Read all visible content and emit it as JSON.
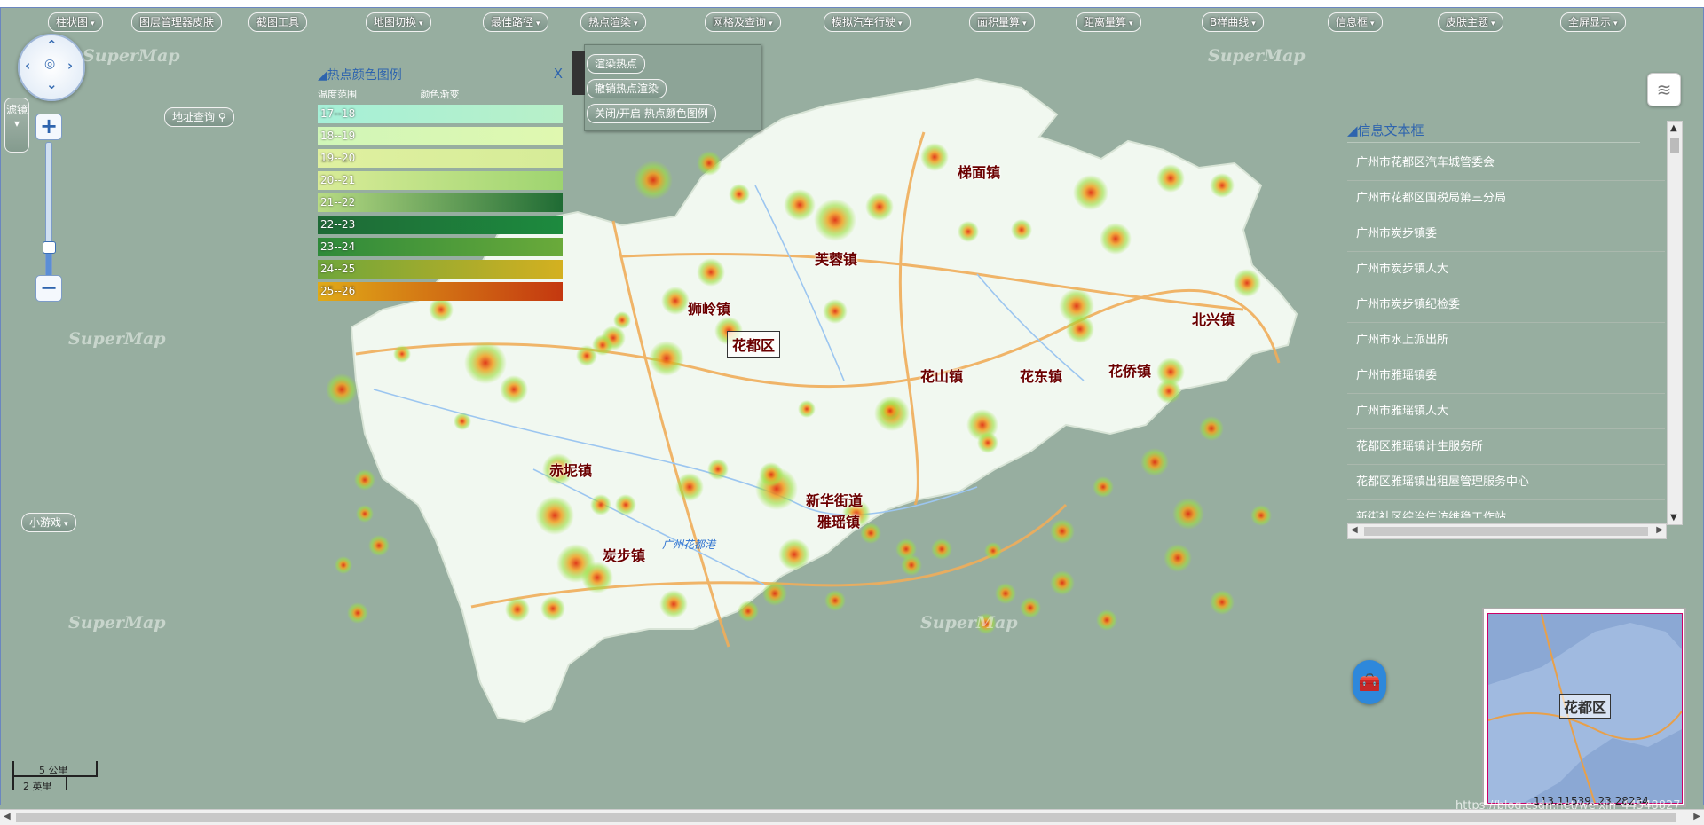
{
  "toolbar": {
    "items": [
      "柱状图",
      "图层管理器皮肤",
      "截图工具",
      "地图切换",
      "最佳路径",
      "热点渲染",
      "网格及查询",
      "模拟汽车行驶",
      "面积量算",
      "距离量算",
      "B样曲线",
      "信息框",
      "皮肤主题",
      "全屏显示"
    ]
  },
  "controls": {
    "filter": "滤镜",
    "address_query": "地址查询",
    "mini_game": "小游戏"
  },
  "watermark": "SuperMap",
  "hotspot_menu": {
    "items": [
      "渲染热点",
      "撤销热点渲染",
      "关闭/开启 热点颜色图例"
    ]
  },
  "legend": {
    "title": "热点颜色图例",
    "close": "X",
    "col_range": "温度范围",
    "col_gradient": "颜色渐变",
    "rows": [
      "17--18",
      "18--19",
      "19--20",
      "20--21",
      "21--22",
      "22--23",
      "23--24",
      "24--25",
      "25--26"
    ],
    "colors": [
      [
        "#a6f0d8",
        "#b8f0c8"
      ],
      [
        "#d0f6b8",
        "#e0f8b0"
      ],
      [
        "#dff0a0",
        "#d6ec98"
      ],
      [
        "#d9ec98",
        "#9ed470"
      ],
      [
        "#b8dc84",
        "#1f6b34"
      ],
      [
        "#1e6a36",
        "#1d8a3e"
      ],
      [
        "#2e8a3a",
        "#6aaa3a"
      ],
      [
        "#6fa63a",
        "#d4b020"
      ],
      [
        "#e0aa18",
        "#c43810"
      ]
    ]
  },
  "info_panel": {
    "title": "信息文本框",
    "items": [
      "广州市花都区汽车城管委会",
      "广州市花都区国税局第三分局",
      "广州市炭步镇委",
      "广州市炭步镇人大",
      "广州市炭步镇纪检委",
      "广州市水上派出所",
      "广州市雅瑶镇委",
      "广州市雅瑶镇人大",
      "花都区雅瑶镇计生服务所",
      "花都区雅瑶镇出租屋管理服务中心",
      "新街社区综治信访维稳工作站"
    ]
  },
  "map": {
    "district": "花都区",
    "places": [
      "梯面镇",
      "芙蓉镇",
      "狮岭镇",
      "北兴镇",
      "花山镇",
      "花东镇",
      "花侨镇",
      "新华街道",
      "雅瑶镇",
      "炭步镇",
      "赤坭镇"
    ],
    "river": "广州花都港"
  },
  "scale": {
    "km": "5 公里",
    "mi": "2 英里"
  },
  "overview": {
    "label": "花都区"
  },
  "coords": "113.11539, 23.28234",
  "blog_watermark": "https://blog.csdn.net/weixin_44548827"
}
